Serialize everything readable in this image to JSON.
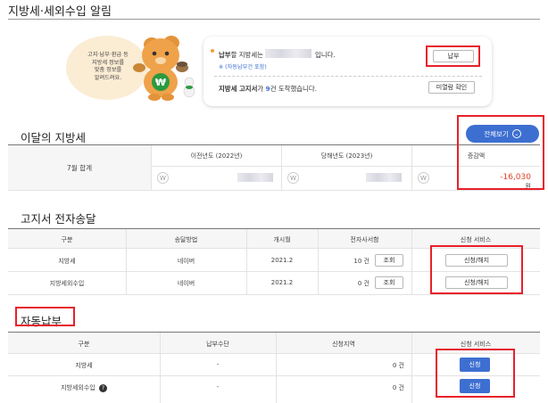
{
  "page": {
    "title": "지방세·세외수입 알림"
  },
  "banner": {
    "character_text": [
      "고지·납부·환급 등",
      "지방세 정보를",
      "맞춤 정보를",
      "알려드려요."
    ],
    "payment_pre": "납부",
    "payment_mid": "할 지방세는",
    "payment_post": "입니다.",
    "autopay_note": "※ (자동납부건 포함)",
    "pay_button": "납부",
    "notice_pre": "지방세 고지서",
    "notice_mid": "가",
    "notice_count": "9",
    "notice_post": "건 도착했습니다.",
    "unread_button": "미열람 확인",
    "badge_letter": "₩"
  },
  "monthly": {
    "title": "이달의 지방세",
    "view_all_button": "전체보기",
    "row_label": "7월 합계",
    "headers": [
      "이전년도 (2022년)",
      "당해년도 (2023년)",
      "증감액"
    ],
    "won_symbol": "W",
    "change_value": "-16,030",
    "change_unit": "원"
  },
  "bill_delivery": {
    "title": "고지서 전자송달",
    "headers": [
      "구분",
      "송달방법",
      "개시월",
      "전자사서함",
      "신청 서비스"
    ],
    "rows": [
      {
        "type": "지방세",
        "method": "네이버",
        "start": "2021.2",
        "count": "10 건",
        "view_button": "조회",
        "service_button": "신청/해지"
      },
      {
        "type": "지방세외수입",
        "method": "네이버",
        "start": "2021.2",
        "count": "0 건",
        "view_button": "조회",
        "service_button": "신청/해지"
      }
    ]
  },
  "autopay": {
    "title": "자동납부",
    "headers": [
      "구분",
      "납부수단",
      "신청지역",
      "신청 서비스"
    ],
    "rows": [
      {
        "type": "지방세",
        "means": "-",
        "count": "0 건",
        "button": "신청"
      },
      {
        "type": "지방세외수입",
        "means": "-",
        "count": "0 건",
        "button": "신청"
      }
    ]
  },
  "colors": {
    "accent_blue": "#3d6fd1",
    "highlight_red": "#e8202a",
    "negative_text": "#e0402a"
  }
}
